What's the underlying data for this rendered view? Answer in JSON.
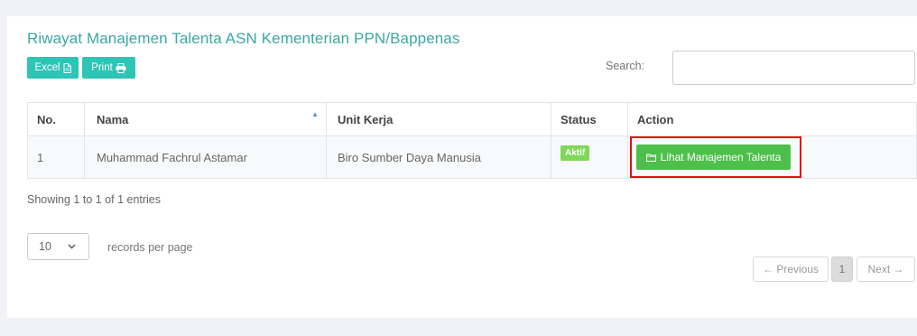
{
  "page": {
    "title": "Riwayat Manajemen Talenta ASN Kementerian PPN/Bappenas"
  },
  "toolbar": {
    "excel_label": "Excel",
    "excel_icon": "file-icon",
    "print_label": "Print",
    "print_icon": "printer-icon"
  },
  "search": {
    "label": "Search:",
    "value": "",
    "placeholder": ""
  },
  "table": {
    "headers": {
      "no": "No.",
      "nama": "Nama",
      "unit_kerja": "Unit Kerja",
      "status": "Status",
      "action": "Action"
    },
    "rows": [
      {
        "no": "1",
        "nama": "Muhammad Fachrul Astamar",
        "unit_kerja": "Biro Sumber Daya Manusia",
        "status": "Aktif",
        "action_label": "Lihat Manajemen Talenta",
        "action_icon": "folder-icon"
      }
    ]
  },
  "footer": {
    "info": "Showing 1 to 1 of 1 entries",
    "page_size": "10",
    "page_size_label": "records per page",
    "prev_label": "← Previous",
    "current_page": "1",
    "next_label": "Next →"
  },
  "colors": {
    "title": "#3aa8a4",
    "export_button": "#2ec4b6",
    "action_button": "#4cc04a",
    "status_badge": "#7ed957",
    "highlight": "#e01010"
  }
}
